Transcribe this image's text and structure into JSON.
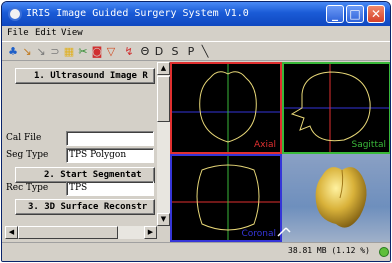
{
  "window": {
    "title": "IRIS Image Guided Surgery System V1.0",
    "minimize": "_",
    "maximize": "□",
    "close": "✕"
  },
  "menu": [
    {
      "label": "File"
    },
    {
      "label": "Edit"
    },
    {
      "label": "View"
    }
  ],
  "toolbar": {
    "tools": [
      {
        "icon": "droplet-icon",
        "glyph": "♣",
        "color": "#1e5fc8"
      },
      {
        "icon": "probe-icon",
        "glyph": "↘",
        "color": "#c07a20"
      },
      {
        "icon": "probe2-icon",
        "glyph": "↘",
        "color": "#7a7a7a"
      },
      {
        "icon": "tube-icon",
        "glyph": "⊃",
        "color": "#7a7a7a"
      },
      {
        "icon": "grid-icon",
        "glyph": "▦",
        "color": "#e0b020"
      },
      {
        "icon": "scissors-icon",
        "glyph": "✂",
        "color": "#2a8a2a"
      },
      {
        "icon": "target-icon",
        "glyph": "◙",
        "color": "#d03030"
      },
      {
        "icon": "shield-icon",
        "glyph": "▽",
        "color": "#d04a20"
      },
      {
        "icon": "warning-icon",
        "glyph": "↯",
        "color": "#d03030"
      },
      {
        "icon": "letter-o-icon",
        "glyph": "Θ",
        "color": "#202020"
      },
      {
        "icon": "letter-d-icon",
        "glyph": "D",
        "color": "#202020"
      },
      {
        "icon": "letter-s-icon",
        "glyph": "S",
        "color": "#202020"
      },
      {
        "icon": "letter-p-icon",
        "glyph": "P",
        "color": "#202020"
      },
      {
        "icon": "slash-icon",
        "glyph": "╲",
        "color": "#202020"
      }
    ]
  },
  "panel": {
    "step1": "1. Ultrasound Image R",
    "cal_file_label": "Cal File",
    "cal_file_value": "",
    "seg_type_label": "Seg Type",
    "seg_type_value": "TPS Polygon",
    "step2": "2. Start Segmentat",
    "rec_type_label": "Rec Type",
    "rec_type_value": "TPS",
    "step3": "3. 3D Surface Reconstr"
  },
  "views": {
    "axial": "Axial",
    "sagittal": "Sagittal",
    "coronal": "Coronal",
    "colors": {
      "axial": "#e03030",
      "sagittal": "#3ab83a",
      "coronal": "#3535d8",
      "contour": "#e8d878"
    }
  },
  "status": {
    "memory": "38.81 MB (1.12 %)"
  }
}
